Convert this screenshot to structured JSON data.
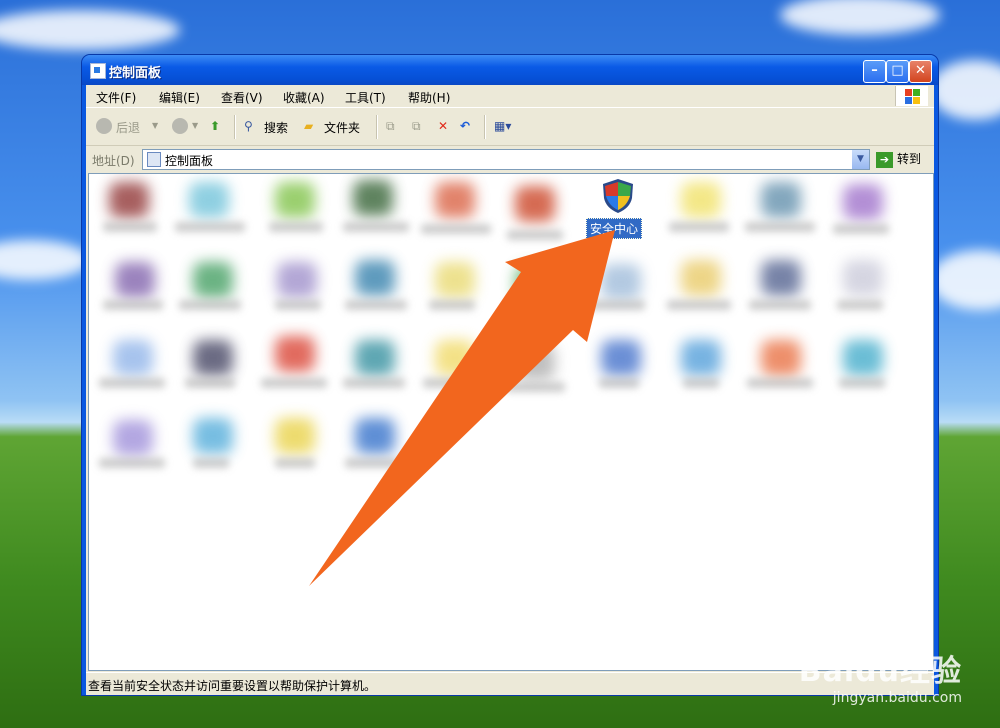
{
  "window": {
    "title": "控制面板"
  },
  "menu": [
    "文件(F)",
    "编辑(E)",
    "查看(V)",
    "收藏(A)",
    "工具(T)",
    "帮助(H)"
  ],
  "toolbar": {
    "back": "后退",
    "search": "搜索",
    "folders": "文件夹"
  },
  "address": {
    "label": "地址(D)",
    "value": "控制面板",
    "go": "转到"
  },
  "content": {
    "selected_item": "安全中心"
  },
  "status": {
    "text": "查看当前安全状态并访问重要设置以帮助保护计算机。"
  },
  "watermark": {
    "brand": "Baidu经验",
    "url": "jingyan.baidu.com"
  },
  "colors": {
    "arrow": "#f2661e",
    "selection": "#316ac5",
    "titlebar": "#0a5ae6"
  }
}
